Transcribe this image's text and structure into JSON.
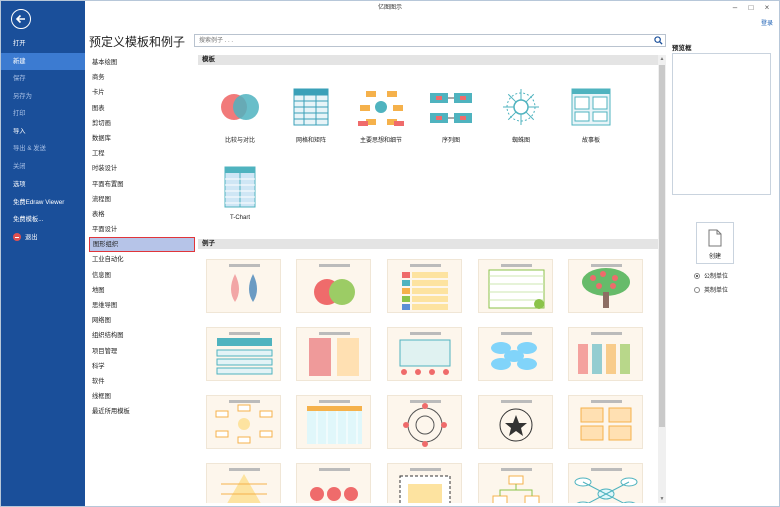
{
  "window": {
    "title": "亿图图示",
    "login": "登录"
  },
  "sidebar": {
    "items": [
      {
        "label": "打开",
        "state": "normal"
      },
      {
        "label": "新建",
        "state": "active"
      },
      {
        "label": "保存",
        "state": "dim"
      },
      {
        "label": "另存为",
        "state": "dim"
      },
      {
        "label": "打印",
        "state": "dim"
      },
      {
        "label": "导入",
        "state": "normal"
      },
      {
        "label": "导出 & 发送",
        "state": "dim"
      },
      {
        "label": "关闭",
        "state": "dim"
      },
      {
        "label": "选项",
        "state": "normal"
      },
      {
        "label": "免费Edraw Viewer",
        "state": "normal"
      },
      {
        "label": "免费模板...",
        "state": "normal"
      },
      {
        "label": "退出",
        "state": "normal"
      }
    ]
  },
  "main": {
    "title": "预定义模板和例子",
    "search_placeholder": "搜索例子 . . .",
    "categories": [
      "基本绘图",
      "商务",
      "卡片",
      "图表",
      "剪切画",
      "数据库",
      "工程",
      "时装设计",
      "平面布置图",
      "流程图",
      "表格",
      "平面设计",
      "图形组织",
      "工业自动化",
      "信息图",
      "地图",
      "思维导图",
      "网络图",
      "组织结构图",
      "项目管理",
      "科学",
      "软件",
      "线框图",
      "最近所用模板"
    ],
    "selected_category": "图形组织",
    "templates_header": "模板",
    "templates": [
      {
        "label": "比较与对比",
        "art": "venn"
      },
      {
        "label": "网格和矩阵",
        "art": "grid"
      },
      {
        "label": "主要思想和细节",
        "art": "mainidea"
      },
      {
        "label": "序列图",
        "art": "sequence"
      },
      {
        "label": "蜘蛛图",
        "art": "spider"
      },
      {
        "label": "故事板",
        "art": "story"
      },
      {
        "label": "T-Chart",
        "art": "tchart"
      }
    ],
    "examples_header": "例子",
    "examples": [
      {
        "art": "drops"
      },
      {
        "art": "apples"
      },
      {
        "art": "arrows"
      },
      {
        "art": "chart"
      },
      {
        "art": "tree"
      },
      {
        "art": "boxes"
      },
      {
        "art": "scroll"
      },
      {
        "art": "garden"
      },
      {
        "art": "clouds"
      },
      {
        "art": "candy"
      },
      {
        "art": "hub"
      },
      {
        "art": "table"
      },
      {
        "art": "web"
      },
      {
        "art": "star"
      },
      {
        "art": "notes"
      },
      {
        "art": "pyramid"
      },
      {
        "art": "strawberry"
      },
      {
        "art": "frames"
      },
      {
        "art": "flow"
      },
      {
        "art": "mindmap"
      }
    ]
  },
  "preview": {
    "label": "预览框"
  },
  "create": {
    "label": "创建"
  },
  "units": [
    {
      "label": "公制单位",
      "checked": true
    },
    {
      "label": "英制单位",
      "checked": false
    }
  ],
  "colors": {
    "sidebar": "#1a4f9a",
    "active": "#3c7bd1",
    "accent": "#e0353a"
  }
}
